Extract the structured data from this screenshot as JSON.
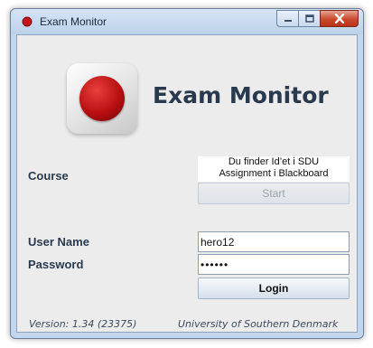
{
  "window": {
    "title": "Exam Monitor",
    "icon": "red-dot-icon",
    "controls": [
      "minimize-icon",
      "maximize-icon",
      "close-icon"
    ]
  },
  "header": {
    "app_title": "Exam Monitor",
    "logo": "red-dot-icon"
  },
  "form": {
    "course_label": "Course",
    "course_info_line1": "Du finder Id’et i SDU",
    "course_info_line2": "Assignment i Blackboard",
    "start_label": "Start",
    "username_label": "User Name",
    "username_value": "hero12",
    "password_label": "Password",
    "password_value": "••••••",
    "login_label": "Login"
  },
  "footer": {
    "version": "Version: 1.34 (23375)",
    "organization": "University of Southern Denmark"
  },
  "colors": {
    "titlebar": "#c2d7ee",
    "close_button": "#c9492c",
    "logo_red": "#b90f12",
    "label_text": "#2a3a4e"
  }
}
